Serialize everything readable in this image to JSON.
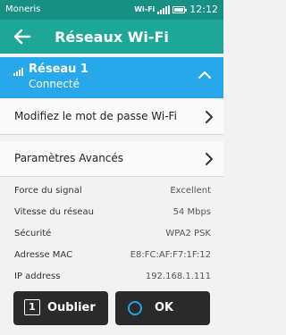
{
  "status": {
    "carrier": "Moneris",
    "wifi_label": "Wi-Fi",
    "time": "12:12"
  },
  "header": {
    "title": "Réseaux Wi-Fi"
  },
  "network": {
    "name": "Réseau 1",
    "state": "Connecté"
  },
  "menu": [
    {
      "label": "Modifiez le mot de passe Wi-Fi"
    },
    {
      "label": "Paramètres Avancés"
    }
  ],
  "details": [
    {
      "key": "Force du signal",
      "value": "Excellent"
    },
    {
      "key": "Vitesse du réseau",
      "value": "54 Mbps"
    },
    {
      "key": "Sécurité",
      "value": "WPA2 PSK"
    },
    {
      "key": "Adresse MAC",
      "value": "E8:FC:AF:F7:1F:12"
    },
    {
      "key": "IP address",
      "value": "192.168.1.111"
    }
  ],
  "softkeys": {
    "left_number": "1",
    "left_label": "Oublier",
    "right_label": "OK"
  },
  "colors": {
    "status_bar": "#188f83",
    "header": "#1ea696",
    "network_bar": "#27a8ea"
  }
}
